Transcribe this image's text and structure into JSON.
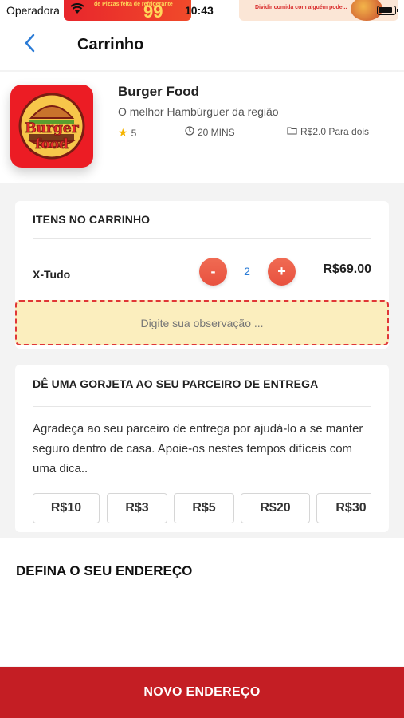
{
  "status_bar": {
    "carrier": "Operadora",
    "time": "10:43",
    "banner_left_text": "de Pizzas feita\nde refrigerante",
    "banner_left_number": "99",
    "banner_right_text": "Dividir comida com\nalguém pode..."
  },
  "nav": {
    "title": "Carrinho",
    "back_icon": "chevron-left-icon"
  },
  "restaurant": {
    "name": "Burger Food",
    "description": "O melhor Hambúrguer da região",
    "logo_text_top": "Burger",
    "logo_text_bottom": "food",
    "rating": "5",
    "time": "20 MINS",
    "price": "R$2.0 Para dois"
  },
  "cart": {
    "heading": "ITENS NO CARRINHO",
    "items": [
      {
        "name": "X-Tudo",
        "quantity": "2",
        "price": "R$69.00",
        "minus_label": "-",
        "plus_label": "+"
      }
    ],
    "note_placeholder": "Digite sua observação ..."
  },
  "tip": {
    "heading": "DÊ UMA GORJETA AO SEU PARCEIRO DE ENTREGA",
    "description": "Agradeça ao seu parceiro de entrega por ajudá-lo a se manter seguro dentro de casa. Apoie-os nestes tempos difíceis com uma dica..",
    "options": [
      "R$10",
      "R$3",
      "R$5",
      "R$20",
      "R$30"
    ]
  },
  "address": {
    "title": "DEFINA O SEU ENDEREÇO",
    "button_label": "NOVO ENDEREÇO"
  },
  "colors": {
    "accent": "#c41e24",
    "qty_button": "#e8513f",
    "link_blue": "#2a7bd6",
    "note_bg": "#fbeebe",
    "note_border": "#e03636",
    "star": "#f5b400"
  }
}
